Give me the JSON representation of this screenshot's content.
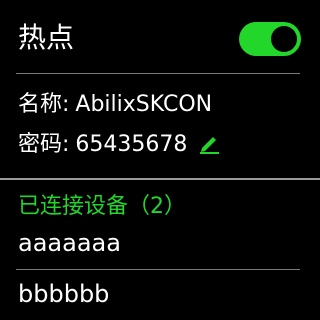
{
  "header": {
    "title": "热点",
    "toggle_on": true,
    "toggle_color": "#22d62a"
  },
  "info": {
    "name_label": "名称:",
    "name_value": "AbilixSKCON",
    "password_label": "密码:",
    "password_value": "65435678",
    "edit_icon": "pencil-edit-icon"
  },
  "connected": {
    "header": "已连接设备（2）",
    "header_color": "#22d62a",
    "devices": [
      "aaaaaaa",
      "bbbbbb"
    ]
  }
}
